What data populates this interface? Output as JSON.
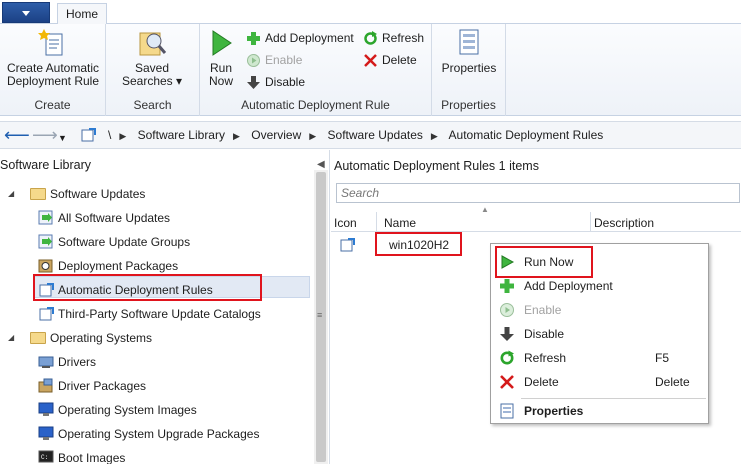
{
  "ribbon": {
    "tab_home": "Home",
    "create_adr_label": "Create Automatic\nDeployment Rule",
    "create_group": "Create",
    "saved_searches_label": "Saved\nSearches",
    "search_group": "Search",
    "run_now_label": "Run\nNow",
    "add_deployment_label": "Add Deployment",
    "enable_label": "Enable",
    "disable_label": "Disable",
    "refresh_label": "Refresh",
    "delete_label": "Delete",
    "adr_group": "Automatic Deployment Rule",
    "properties_label": "Properties",
    "properties_group": "Properties"
  },
  "address_bar": {
    "root": "\\",
    "crumbs": [
      "Software Library",
      "Overview",
      "Software Updates",
      "Automatic Deployment Rules"
    ]
  },
  "tree": {
    "title": "Software Library",
    "nodes": [
      {
        "label": "Software Updates",
        "icon": "folder-icon"
      },
      {
        "label": "All Software Updates",
        "icon": "software-update-icon"
      },
      {
        "label": "Software Update Groups",
        "icon": "update-group-icon"
      },
      {
        "label": "Deployment Packages",
        "icon": "package-icon"
      },
      {
        "label": "Automatic Deployment Rules",
        "icon": "adr-icon"
      },
      {
        "label": "Third-Party Software Update Catalogs",
        "icon": "catalog-icon"
      },
      {
        "label": "Operating Systems",
        "icon": "folder-icon"
      },
      {
        "label": "Drivers",
        "icon": "driver-icon"
      },
      {
        "label": "Driver Packages",
        "icon": "driver-package-icon"
      },
      {
        "label": "Operating System Images",
        "icon": "os-image-icon"
      },
      {
        "label": "Operating System Upgrade Packages",
        "icon": "os-upgrade-icon"
      },
      {
        "label": "Boot Images",
        "icon": "boot-image-icon"
      }
    ]
  },
  "pane": {
    "title": "Automatic Deployment Rules 1 items",
    "search_placeholder": "Search",
    "columns": [
      "Icon",
      "Name",
      "Description"
    ],
    "rows": [
      {
        "name": "win1020H2"
      }
    ]
  },
  "context_menu": {
    "items": [
      {
        "label": "Run Now",
        "key": "",
        "icon": "run-now-icon"
      },
      {
        "label": "Add Deployment",
        "key": "",
        "icon": "add-deployment-icon"
      },
      {
        "label": "Enable",
        "key": "",
        "icon": "enable-icon"
      },
      {
        "label": "Disable",
        "key": "",
        "icon": "disable-icon"
      },
      {
        "label": "Refresh",
        "key": "F5",
        "icon": "refresh-icon"
      },
      {
        "label": "Delete",
        "key": "Delete",
        "icon": "delete-icon"
      },
      {
        "label": "Properties",
        "key": "",
        "icon": "properties-icon"
      }
    ]
  },
  "colors": {
    "highlight": "#e0141d",
    "green": "#2ca52c",
    "selected_row": "#e2e9f4"
  }
}
